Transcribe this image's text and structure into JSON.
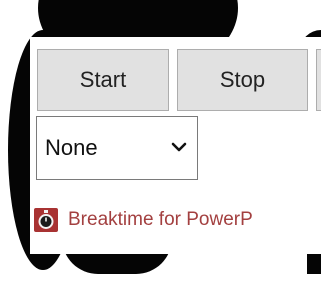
{
  "controls": {
    "start_label": "Start",
    "stop_label": "Stop",
    "third_label": ""
  },
  "mode_select": {
    "selected": "None"
  },
  "footer": {
    "icon": "stopwatch-icon",
    "link_text": "Breaktime for PowerP"
  },
  "colors": {
    "button_bg": "#e1e1e1",
    "link": "#a34040",
    "icon_bg": "#a83232",
    "background_shape": "#050505"
  }
}
